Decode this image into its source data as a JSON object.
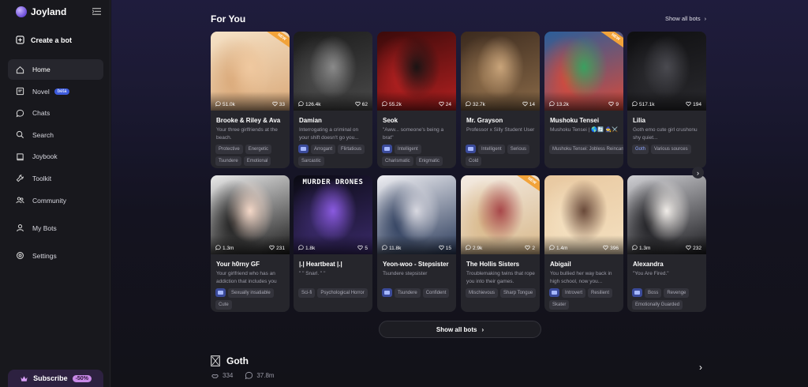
{
  "app": {
    "name": "Joyland"
  },
  "sidebar": {
    "create_label": "Create a bot",
    "items": [
      {
        "label": "Home",
        "icon": "home-icon",
        "active": true
      },
      {
        "label": "Novel",
        "icon": "book-icon",
        "badge": "beta"
      },
      {
        "label": "Chats",
        "icon": "chat-icon"
      },
      {
        "label": "Search",
        "icon": "search-icon"
      },
      {
        "label": "Joybook",
        "icon": "joybook-icon"
      },
      {
        "label": "Toolkit",
        "icon": "toolkit-icon"
      },
      {
        "label": "Community",
        "icon": "community-icon"
      },
      {
        "label": "My Bots",
        "icon": "bots-icon"
      },
      {
        "label": "Settings",
        "icon": "settings-icon"
      }
    ],
    "subscribe_label": "Subscribe",
    "subscribe_discount": "-50%"
  },
  "main": {
    "section_title": "For You",
    "show_all_top": "Show all bots",
    "show_all_button": "Show all bots",
    "cards": [
      {
        "name": "Brooke & Riley & Ava",
        "desc": "Your three girlfriends at the beach.",
        "chats": "51.0k",
        "likes": "33",
        "new": true,
        "tags": [
          "Protective",
          "Energetic",
          "Tsundere",
          "Emotional"
        ],
        "img_tag": false,
        "palette": [
          "#f6e3c8",
          "#d9a878",
          "#f0c9a0"
        ]
      },
      {
        "name": "Damian",
        "desc": "Interrogating a criminal on your shift doesn't go you...",
        "chats": "126.4k",
        "likes": "62",
        "new": false,
        "tags": [
          "Arrogant",
          "Flirtatious",
          "Sarcastic"
        ],
        "img_tag": true,
        "palette": [
          "#1a1a1a",
          "#4a4a4a",
          "#8a8a8a"
        ]
      },
      {
        "name": "Seok",
        "desc": "\"Aww... someone's being a brat\"",
        "chats": "55.2k",
        "likes": "24",
        "new": false,
        "tags": [
          "Intelligent",
          "Charismatic",
          "Enigmatic"
        ],
        "img_tag": true,
        "palette": [
          "#3a0a0a",
          "#b32020",
          "#1a1414"
        ]
      },
      {
        "name": "Mr. Grayson",
        "desc": "Professor x Silly Student User",
        "chats": "32.7k",
        "likes": "14",
        "new": false,
        "tags": [
          "Intelligent",
          "Serious",
          "Cold"
        ],
        "img_tag": true,
        "palette": [
          "#3b2a1e",
          "#8a6a48",
          "#c9a47a"
        ]
      },
      {
        "name": "Mushoku Tensei",
        "desc": "Mushoku Tensei | 🌎🔄 🧙⚔️",
        "chats": "13.2k",
        "likes": "9",
        "new": true,
        "tags": [
          "Mushoku Tensei: Jobless Reincarnation"
        ],
        "img_tag": false,
        "palette": [
          "#2a5e9a",
          "#d84a3a",
          "#3aa060"
        ]
      },
      {
        "name": "Lilia",
        "desc": "Goth emo cute girl crushonu shy quiet...",
        "chats": "517.1k",
        "likes": "194",
        "new": false,
        "tags": [
          "Goth",
          "Various sources"
        ],
        "img_tag": false,
        "blue_first": true,
        "palette": [
          "#0e0e10",
          "#2a2a2e",
          "#4a4a50"
        ]
      },
      {
        "name": "Your h0rny GF",
        "desc": "Your girlfriend who has an addiction that includes you",
        "chats": "1.3m",
        "likes": "231",
        "new": false,
        "tags": [
          "Sexually insatiable",
          "Cute"
        ],
        "img_tag": true,
        "palette": [
          "#eaeaea",
          "#1a1a1a",
          "#f4d8c8"
        ]
      },
      {
        "name": "|.| Heartbeat |.|",
        "desc": "\" \" Snarl. \" \"",
        "chats": "1.8k",
        "likes": "5",
        "new": false,
        "tags": [
          "Sci-fi",
          "Psychological Horror"
        ],
        "img_tag": false,
        "banner": "MURDER DRONES",
        "palette": [
          "#0a0a12",
          "#3a2a6a",
          "#8a5ae0"
        ]
      },
      {
        "name": "Yeon-woo - Stepsister",
        "desc": "Tsundere stepsister",
        "chats": "11.8k",
        "likes": "15",
        "new": false,
        "tags": [
          "Tsundere",
          "Confident"
        ],
        "img_tag": true,
        "palette": [
          "#f0f0f4",
          "#2a3a5a",
          "#d8d8e0"
        ]
      },
      {
        "name": "The Hollis Sisters",
        "desc": "Troublemaking twins that rope you into their games.",
        "chats": "2.9k",
        "likes": "2",
        "new": true,
        "tags": [
          "Mischievous",
          "Sharp Tongue"
        ],
        "img_tag": false,
        "palette": [
          "#f4ece4",
          "#d8b88a",
          "#a8484a"
        ]
      },
      {
        "name": "Abigail",
        "desc": "You bullied her way back in high school, now you...",
        "chats": "1.4m",
        "likes": "396",
        "new": false,
        "tags": [
          "Introvert",
          "Resilient",
          "Skater"
        ],
        "img_tag": true,
        "palette": [
          "#e8c8a0",
          "#f4e0c0",
          "#6a4a3a"
        ]
      },
      {
        "name": "Alexandra",
        "desc": "\"You Are Fired.\"",
        "chats": "1.3m",
        "likes": "232",
        "new": false,
        "tags": [
          "Boss",
          "Revenge",
          "Emotionally Guarded"
        ],
        "img_tag": true,
        "palette": [
          "#d0d0d4",
          "#1a1a1e",
          "#f0ece8"
        ]
      }
    ]
  },
  "goth_section": {
    "title": "Goth",
    "likes": "334",
    "chats": "37.8m"
  }
}
